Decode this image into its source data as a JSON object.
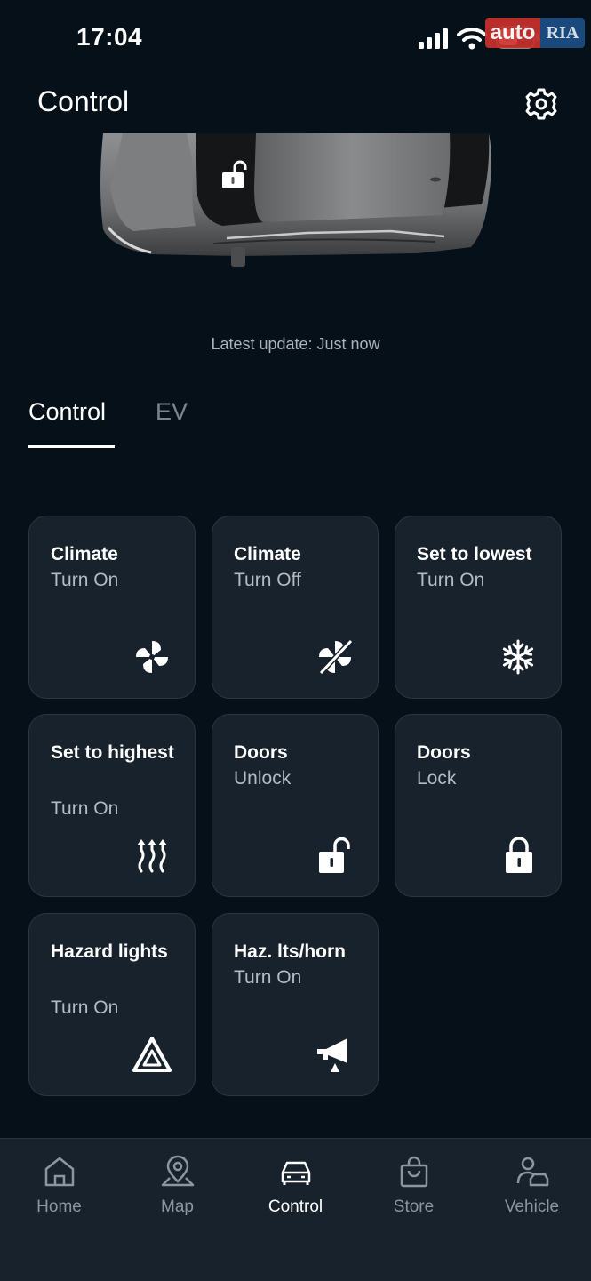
{
  "status_bar": {
    "time": "17:04"
  },
  "watermark": {
    "left": "auto",
    "right": "RIA"
  },
  "header": {
    "title": "Control",
    "settings_icon": "gear-icon"
  },
  "vehicle": {
    "lock_state_icon": "unlocked-padlock-icon",
    "update_text": "Latest update: Just now"
  },
  "tabs": [
    {
      "label": "Control",
      "active": true
    },
    {
      "label": "EV",
      "active": false
    }
  ],
  "tiles": [
    {
      "title": "Climate",
      "subtitle": "Turn On",
      "icon": "fan-icon"
    },
    {
      "title": "Climate",
      "subtitle": "Turn Off",
      "icon": "fan-off-icon"
    },
    {
      "title": "Set to lowest",
      "subtitle": "Turn On",
      "icon": "snowflake-icon"
    },
    {
      "title": "Set to highest",
      "subtitle": "Turn On",
      "icon": "heat-waves-icon"
    },
    {
      "title": "Doors",
      "subtitle": "Unlock",
      "icon": "unlock-icon"
    },
    {
      "title": "Doors",
      "subtitle": "Lock",
      "icon": "lock-icon"
    },
    {
      "title": "Hazard lights",
      "subtitle": "Turn On",
      "icon": "hazard-triangle-icon"
    },
    {
      "title": "Haz. lts/horn",
      "subtitle": "Turn On",
      "icon": "horn-icon"
    }
  ],
  "nav": [
    {
      "label": "Home",
      "icon": "home-icon",
      "active": false
    },
    {
      "label": "Map",
      "icon": "map-pin-icon",
      "active": false
    },
    {
      "label": "Control",
      "icon": "car-icon",
      "active": true
    },
    {
      "label": "Store",
      "icon": "shopping-bag-icon",
      "active": false
    },
    {
      "label": "Vehicle",
      "icon": "person-car-icon",
      "active": false
    }
  ],
  "colors": {
    "background": "#061019",
    "tile": "#18222c",
    "text_muted": "#b4bbc2",
    "nav_inactive": "#8d969f"
  }
}
